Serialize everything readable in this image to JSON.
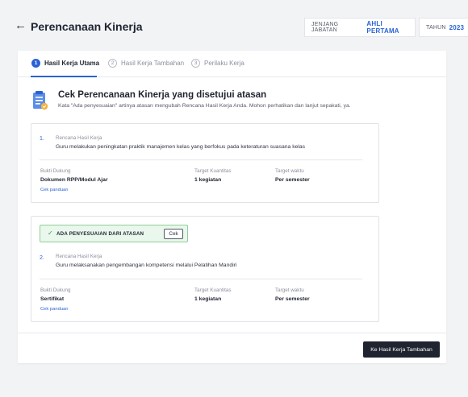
{
  "header": {
    "title": "Perencanaan Kinerja",
    "jenjang_label": "JENJANG JABATAN",
    "jenjang_value": "AHLI PERTAMA",
    "tahun_label": "TAHUN",
    "tahun_value": "2023"
  },
  "tabs": [
    {
      "number": "1",
      "label": "Hasil Kerja Utama",
      "active": true
    },
    {
      "number": "2",
      "label": "Hasil Kerja Tambahan",
      "active": false
    },
    {
      "number": "3",
      "label": "Perilaku Kerja",
      "active": false
    }
  ],
  "notice": {
    "title": "Cek Perencanaan Kinerja yang disetujui atasan",
    "text": "Kata \"Ada penyesuaian\" artinya atasan mengubah Rencana Hasil Kerja Anda. Mohon perhatikan dan lanjut sepakati, ya.",
    "icon": "document-checklist-icon"
  },
  "columns": {
    "bukti": "Bukti Dukung",
    "kuantitas": "Target Kuantitas",
    "waktu": "Target waktu"
  },
  "items": [
    {
      "number": "1.",
      "label": "Rencana Hasil Kerja",
      "text": "Guru melakukan peningkatan praktik manajemen kelas yang berfokus pada keteraturan suasana kelas",
      "bukti": "Dokumen RPP/Modul Ajar",
      "kuantitas": "1 kegiatan",
      "waktu": "Per semester",
      "link": "Cek panduan"
    },
    {
      "number": "2.",
      "label": "Rencana Hasil Kerja",
      "text": "Guru melaksanakan pengembangan kompetensi melalui Pelatihan Mandiri",
      "bukti": "Sertifikat",
      "kuantitas": "1 kegiatan",
      "waktu": "Per semester",
      "link": "Cek panduan",
      "adjustment": {
        "label": "ADA PENYESUAIAN DARI ATASAN",
        "button": "Cek"
      }
    }
  ],
  "footer": {
    "next_label": "Ke Hasil Kerja Tambahan"
  },
  "colors": {
    "accent": "#2a62d4",
    "success": "#3b9c4a",
    "dark": "#1f2430"
  }
}
